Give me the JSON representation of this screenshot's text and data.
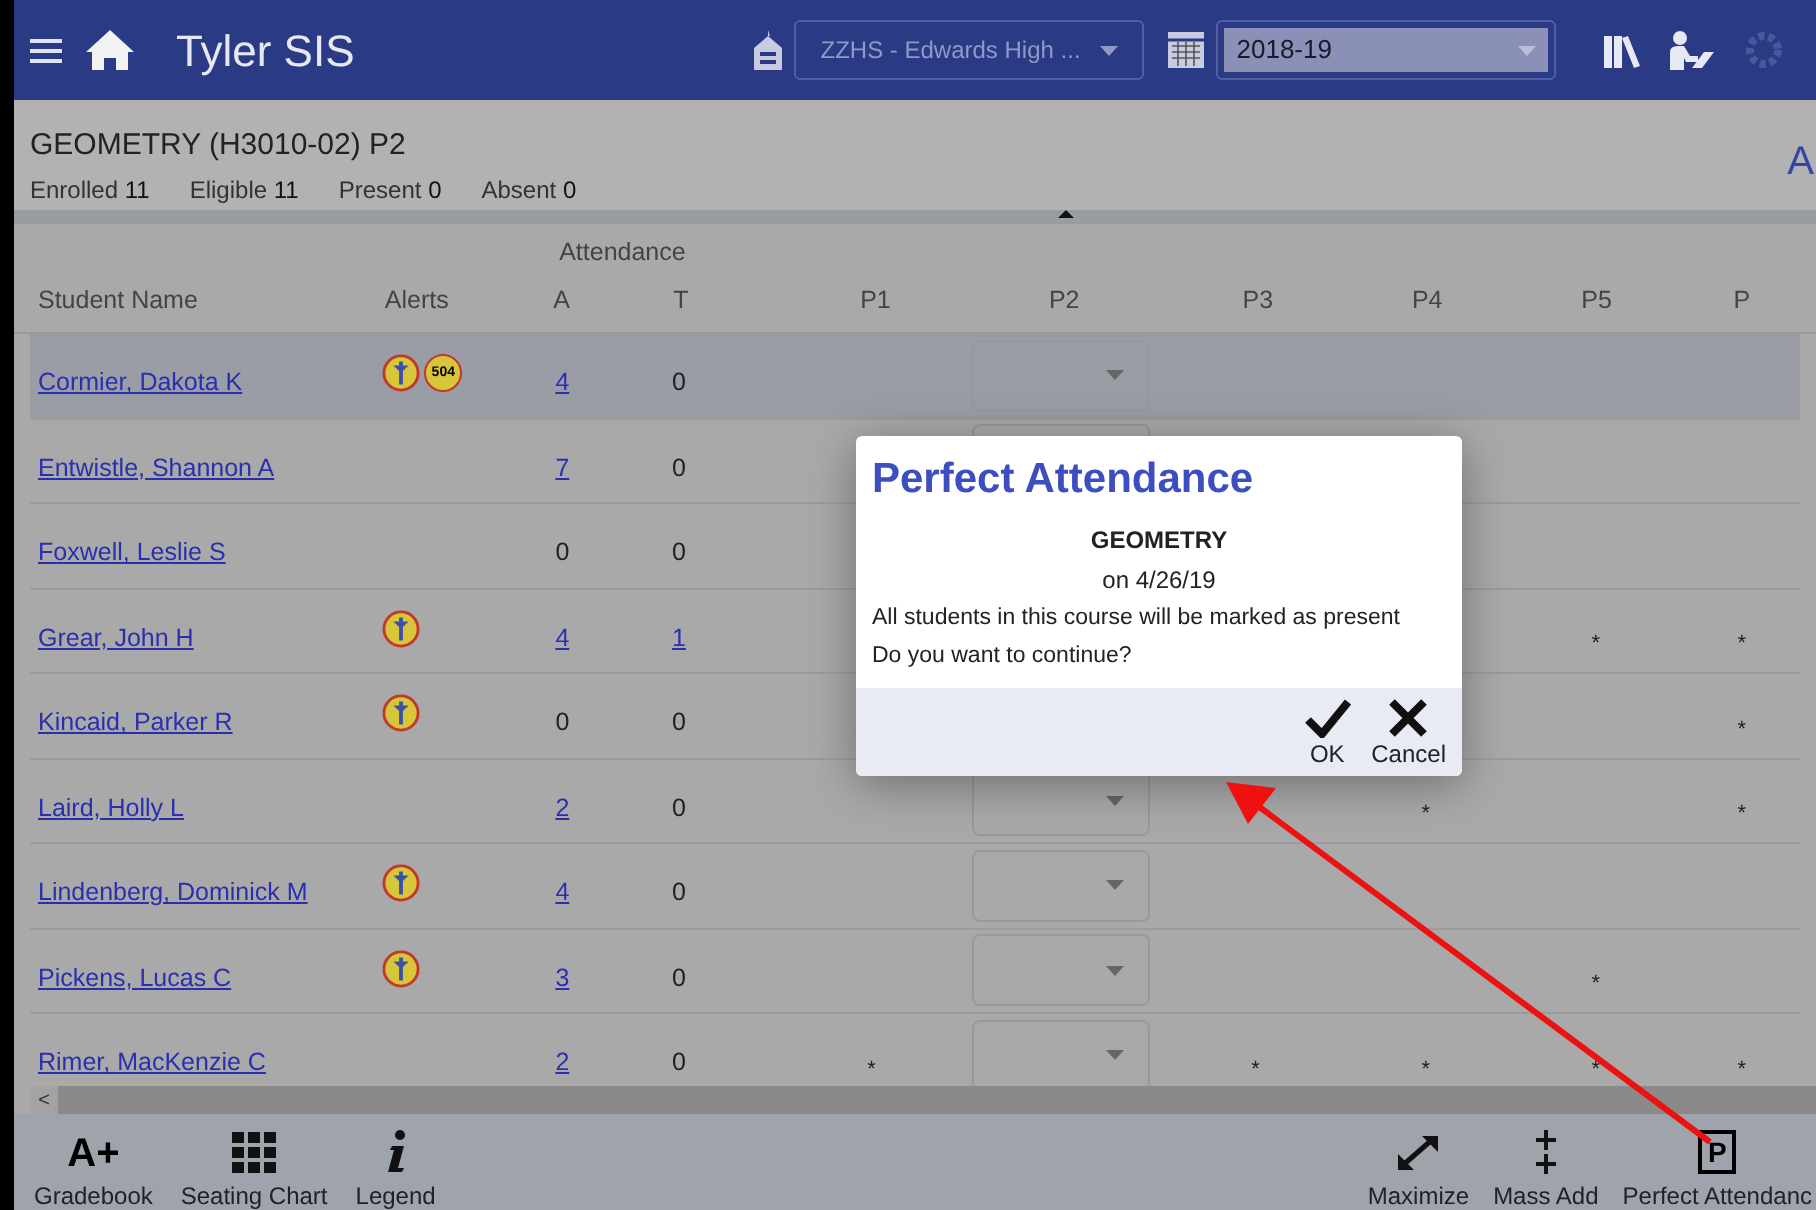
{
  "app": {
    "title": "Tyler SIS",
    "school": "ZZHS - Edwards High ...",
    "year": "2018-19"
  },
  "section": {
    "title": "GEOMETRY (H3010-02) P2",
    "edge_text": "A",
    "stats": [
      {
        "label": "Enrolled",
        "value": "11"
      },
      {
        "label": "Eligible",
        "value": "11"
      },
      {
        "label": "Present",
        "value": "0"
      },
      {
        "label": "Absent",
        "value": "0"
      }
    ]
  },
  "table": {
    "columns": {
      "name": "Student Name",
      "alerts": "Alerts",
      "group": "Attendance",
      "a": "A",
      "t": "T",
      "periods": [
        "P1",
        "P2",
        "P3",
        "P4",
        "P5",
        "P"
      ]
    },
    "rows": [
      {
        "name": "Cormier, Dakota K",
        "selected": true,
        "alerts": [
          {
            "kind": "medical"
          },
          {
            "kind": "plan",
            "label": "504"
          }
        ],
        "a": {
          "text": "4",
          "link": true
        },
        "t": {
          "text": "0",
          "link": false
        }
      },
      {
        "name": "Entwistle, Shannon A",
        "selected": false,
        "a": {
          "text": "7",
          "link": true
        },
        "t": {
          "text": "0",
          "link": false
        }
      },
      {
        "name": "Foxwell, Leslie S",
        "selected": false,
        "a": {
          "text": "0",
          "link": false
        },
        "t": {
          "text": "0",
          "link": false
        }
      },
      {
        "name": "Grear, John H",
        "selected": false,
        "alerts": [
          {
            "kind": "medical"
          }
        ],
        "a": {
          "text": "4",
          "link": true
        },
        "t": {
          "text": "1",
          "link": true
        },
        "p5": "*",
        "p6": "*"
      },
      {
        "name": "Kincaid, Parker R",
        "selected": false,
        "alerts": [
          {
            "kind": "medical"
          }
        ],
        "a": {
          "text": "0",
          "link": false
        },
        "t": {
          "text": "0",
          "link": false
        },
        "p6": "*"
      },
      {
        "name": "Laird, Holly L",
        "selected": false,
        "a": {
          "text": "2",
          "link": true
        },
        "t": {
          "text": "0",
          "link": false
        },
        "p4": "*",
        "p6": "*"
      },
      {
        "name": "Lindenberg, Dominick M",
        "selected": false,
        "alerts": [
          {
            "kind": "medical"
          }
        ],
        "a": {
          "text": "4",
          "link": true
        },
        "t": {
          "text": "0",
          "link": false
        }
      },
      {
        "name": "Pickens, Lucas C",
        "selected": false,
        "alerts": [
          {
            "kind": "medical"
          }
        ],
        "a": {
          "text": "3",
          "link": true
        },
        "t": {
          "text": "0",
          "link": false
        },
        "p5": "*"
      },
      {
        "name": "Rimer, MacKenzie C",
        "selected": false,
        "a": {
          "text": "2",
          "link": true
        },
        "t": {
          "text": "0",
          "link": false
        },
        "p1": "*",
        "p3": "*",
        "p4": "*",
        "p5": "*",
        "p6": "*"
      }
    ]
  },
  "scrollbar": {
    "left": "<"
  },
  "toolbar": {
    "left": [
      {
        "kind": "grade",
        "icon_text": "A+",
        "label": "Gradebook"
      },
      {
        "kind": "grid",
        "label": "Seating Chart"
      },
      {
        "kind": "info",
        "label": "Legend"
      }
    ],
    "right": [
      {
        "kind": "maximize",
        "label": "Maximize"
      },
      {
        "kind": "add",
        "label": "Mass Add"
      },
      {
        "kind": "boxed",
        "icon_text": "P",
        "label": "Perfect Attendanc"
      }
    ]
  },
  "dialog": {
    "title": "Perfect Attendance",
    "course": "GEOMETRY",
    "date": "on 4/26/19",
    "lines": [
      "All students in this course will be marked as present",
      "Do you want to continue?"
    ],
    "buttons": [
      {
        "kind": "ok",
        "label": "OK"
      },
      {
        "kind": "cancel",
        "label": "Cancel"
      }
    ]
  }
}
